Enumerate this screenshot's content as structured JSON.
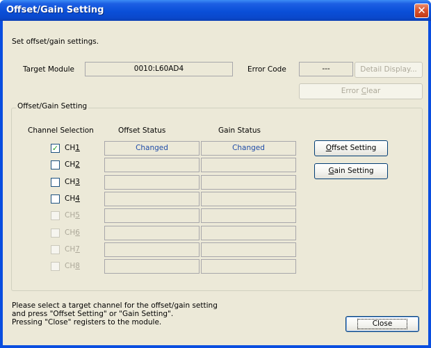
{
  "window": {
    "title": "Offset/Gain Setting",
    "close_glyph": "✕"
  },
  "header": {
    "instruction": "Set offset/gain settings.",
    "target_module_label": "Target Module",
    "target_module_value": "0010:L60AD4",
    "error_code_label": "Error Code",
    "error_code_value": "---",
    "detail_display_label": "Detail Display...",
    "error_clear_pre": "Error ",
    "error_clear_mnemonic": "C",
    "error_clear_post": "lear"
  },
  "group": {
    "title": "Offset/Gain Setting",
    "col_channel": "Channel Selection",
    "col_offset": "Offset Status",
    "col_gain": "Gain Status",
    "offset_btn_mnemonic": "O",
    "offset_btn_rest": "ffset Setting",
    "gain_btn_mnemonic": "G",
    "gain_btn_rest": "ain Setting"
  },
  "channels": [
    {
      "prefix": "CH",
      "num": "1",
      "checked": true,
      "enabled": true,
      "offset": "Changed",
      "gain": "Changed"
    },
    {
      "prefix": "CH",
      "num": "2",
      "checked": false,
      "enabled": true,
      "offset": "",
      "gain": ""
    },
    {
      "prefix": "CH",
      "num": "3",
      "checked": false,
      "enabled": true,
      "offset": "",
      "gain": ""
    },
    {
      "prefix": "CH",
      "num": "4",
      "checked": false,
      "enabled": true,
      "offset": "",
      "gain": ""
    },
    {
      "prefix": "CH",
      "num": "5",
      "checked": false,
      "enabled": false,
      "offset": "",
      "gain": ""
    },
    {
      "prefix": "CH",
      "num": "6",
      "checked": false,
      "enabled": false,
      "offset": "",
      "gain": ""
    },
    {
      "prefix": "CH",
      "num": "7",
      "checked": false,
      "enabled": false,
      "offset": "",
      "gain": ""
    },
    {
      "prefix": "CH",
      "num": "8",
      "checked": false,
      "enabled": false,
      "offset": "",
      "gain": ""
    }
  ],
  "footer": {
    "line1": "Please select a target channel for the offset/gain setting",
    "line2": "and press \"Offset Setting\" or \"Gain Setting\".",
    "line3": "Pressing \"Close\" registers to the module.",
    "close_label": "Close"
  },
  "colors": {
    "titlebar": "#0a4fd8",
    "dialog_bg": "#ece9d8",
    "status_text": "#1f4ca8",
    "disabled_text": "#aca899"
  }
}
